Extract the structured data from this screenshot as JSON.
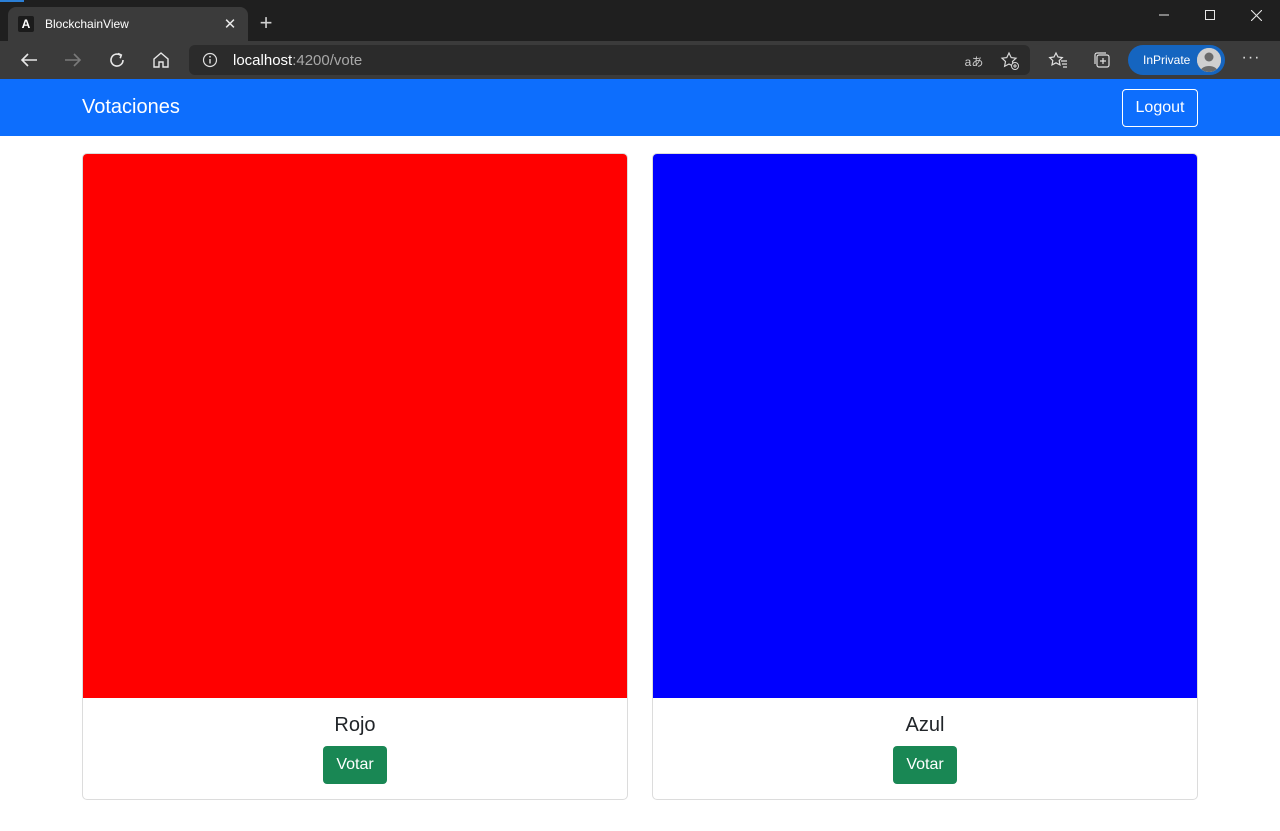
{
  "browser": {
    "tab": {
      "title": "BlockchainView",
      "favicon_letter": "A"
    },
    "url": {
      "host": "localhost",
      "path": ":4200/vote"
    },
    "profile_label": "InPrivate",
    "icons": {
      "back": "back-arrow-icon",
      "forward": "forward-arrow-icon",
      "refresh": "refresh-icon",
      "home": "home-icon",
      "info": "info-icon",
      "read_aloud": "read-aloud-icon",
      "add_favorite": "add-favorite-icon",
      "favorites": "favorites-icon",
      "collections": "collections-icon",
      "more": "more-icon"
    }
  },
  "page": {
    "brand": "Votaciones",
    "logout_label": "Logout",
    "colors": {
      "navbar": "#0d6efd",
      "vote_button": "#198754"
    },
    "candidates": [
      {
        "name": "Rojo",
        "color": "#ff0000",
        "button_label": "Votar"
      },
      {
        "name": "Azul",
        "color": "#0000ff",
        "button_label": "Votar"
      }
    ]
  }
}
